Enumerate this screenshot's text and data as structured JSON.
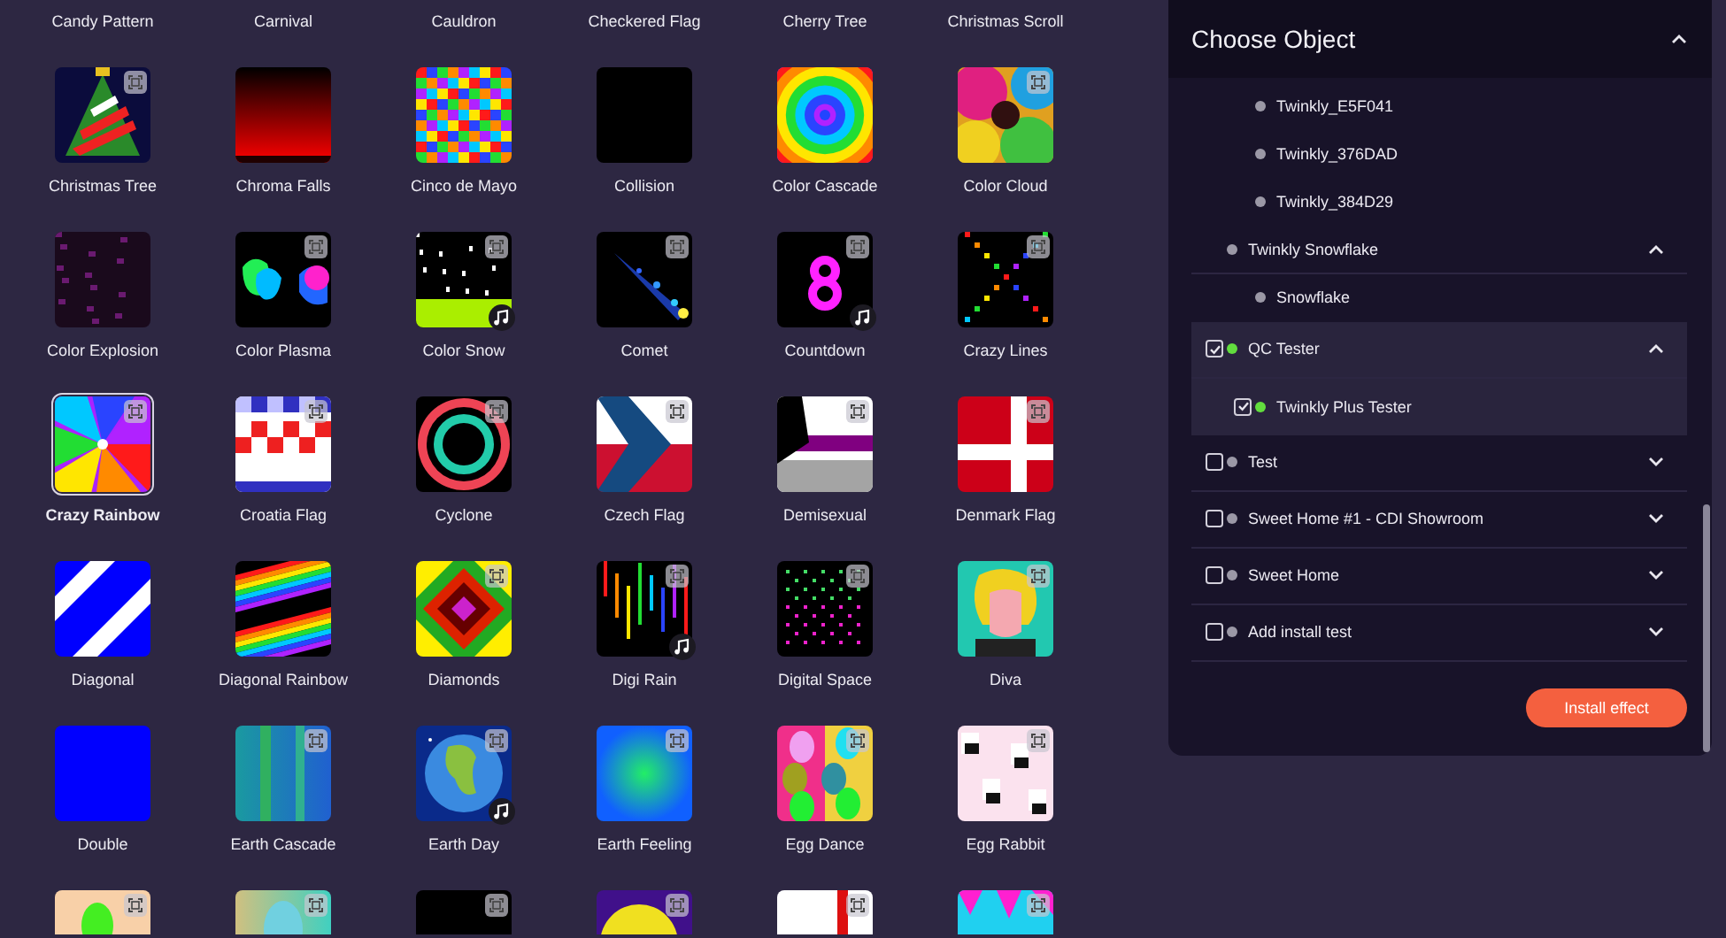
{
  "effects": [
    {
      "kind": "label",
      "label": "Candy Pattern",
      "selected": false
    },
    {
      "kind": "label",
      "label": "Carnival",
      "selected": false
    },
    {
      "kind": "label",
      "label": "Cauldron",
      "selected": false
    },
    {
      "kind": "label",
      "label": "Checkered Flag",
      "selected": false
    },
    {
      "kind": "label",
      "label": "Cherry Tree",
      "selected": false
    },
    {
      "kind": "label",
      "label": "Christmas Scroll",
      "selected": false
    },
    {
      "kind": "tile",
      "label": "Christmas Tree",
      "preview": true,
      "music": false,
      "selected": false
    },
    {
      "kind": "tile",
      "label": "Chroma Falls",
      "preview": false,
      "music": false,
      "selected": false
    },
    {
      "kind": "tile",
      "label": "Cinco de Mayo",
      "preview": false,
      "music": false,
      "selected": false
    },
    {
      "kind": "tile",
      "label": "Collision",
      "preview": false,
      "music": false,
      "selected": false
    },
    {
      "kind": "tile",
      "label": "Color Cascade",
      "preview": false,
      "music": false,
      "selected": false
    },
    {
      "kind": "tile",
      "label": "Color Cloud",
      "preview": true,
      "music": false,
      "selected": false
    },
    {
      "kind": "tile",
      "label": "Color Explosion",
      "preview": false,
      "music": false,
      "selected": false
    },
    {
      "kind": "tile",
      "label": "Color Plasma",
      "preview": true,
      "music": false,
      "selected": false
    },
    {
      "kind": "tile",
      "label": "Color Snow",
      "preview": true,
      "music": true,
      "selected": false
    },
    {
      "kind": "tile",
      "label": "Comet",
      "preview": true,
      "music": false,
      "selected": false
    },
    {
      "kind": "tile",
      "label": "Countdown",
      "preview": true,
      "music": true,
      "selected": false
    },
    {
      "kind": "tile",
      "label": "Crazy Lines",
      "preview": true,
      "music": false,
      "selected": false
    },
    {
      "kind": "tile",
      "label": "Crazy Rainbow",
      "preview": true,
      "music": false,
      "selected": true
    },
    {
      "kind": "tile",
      "label": "Croatia Flag",
      "preview": true,
      "music": false,
      "selected": false
    },
    {
      "kind": "tile",
      "label": "Cyclone",
      "preview": true,
      "music": false,
      "selected": false
    },
    {
      "kind": "tile",
      "label": "Czech Flag",
      "preview": true,
      "music": false,
      "selected": false
    },
    {
      "kind": "tile",
      "label": "Demisexual",
      "preview": true,
      "music": false,
      "selected": false
    },
    {
      "kind": "tile",
      "label": "Denmark Flag",
      "preview": true,
      "music": false,
      "selected": false
    },
    {
      "kind": "tile",
      "label": "Diagonal",
      "preview": false,
      "music": false,
      "selected": false
    },
    {
      "kind": "tile",
      "label": "Diagonal Rainbow",
      "preview": false,
      "music": false,
      "selected": false
    },
    {
      "kind": "tile",
      "label": "Diamonds",
      "preview": true,
      "music": false,
      "selected": false
    },
    {
      "kind": "tile",
      "label": "Digi Rain",
      "preview": true,
      "music": true,
      "selected": false
    },
    {
      "kind": "tile",
      "label": "Digital Space",
      "preview": true,
      "music": false,
      "selected": false
    },
    {
      "kind": "tile",
      "label": "Diva",
      "preview": true,
      "music": false,
      "selected": false
    },
    {
      "kind": "tile",
      "label": "Double",
      "preview": false,
      "music": false,
      "selected": false
    },
    {
      "kind": "tile",
      "label": "Earth Cascade",
      "preview": true,
      "music": false,
      "selected": false
    },
    {
      "kind": "tile",
      "label": "Earth Day",
      "preview": true,
      "music": true,
      "selected": false
    },
    {
      "kind": "tile",
      "label": "Earth Feeling",
      "preview": true,
      "music": false,
      "selected": false
    },
    {
      "kind": "tile",
      "label": "Egg Dance",
      "preview": true,
      "music": false,
      "selected": false
    },
    {
      "kind": "tile",
      "label": "Egg Rabbit",
      "preview": true,
      "music": false,
      "selected": false
    },
    {
      "kind": "partial",
      "preview": true,
      "music": false,
      "selected": false
    },
    {
      "kind": "partial",
      "preview": true,
      "music": false,
      "selected": false
    },
    {
      "kind": "partial",
      "preview": true,
      "music": false,
      "selected": false
    },
    {
      "kind": "partial",
      "preview": true,
      "music": false,
      "selected": false
    },
    {
      "kind": "partial",
      "preview": true,
      "music": false,
      "selected": false
    },
    {
      "kind": "partial",
      "preview": true,
      "music": false,
      "selected": false
    }
  ],
  "panel": {
    "title": "Choose Object",
    "expanded": true,
    "objects": [
      {
        "children": [
          {
            "name": "Twinkly_E5F041",
            "online": false
          },
          {
            "name": "Twinkly_376DAD",
            "online": false
          },
          {
            "name": "Twinkly_384D29",
            "online": false
          }
        ]
      },
      {
        "name": "Twinkly Snowflake",
        "online": false,
        "expanded": true,
        "children": [
          {
            "name": "Snowflake",
            "online": false
          }
        ]
      },
      {
        "name": "QC Tester",
        "checked": true,
        "online": true,
        "expanded": true,
        "children": [
          {
            "name": "Twinkly Plus Tester",
            "checked": true,
            "online": true
          }
        ]
      },
      {
        "name": "Test",
        "checked": false,
        "online": false,
        "expanded": false
      },
      {
        "name": "Sweet Home #1 - CDI Showroom",
        "checked": false,
        "online": false,
        "expanded": false
      },
      {
        "name": "Sweet Home",
        "checked": false,
        "online": false,
        "expanded": false
      },
      {
        "name": "Add install test",
        "checked": false,
        "online": false,
        "expanded": false
      }
    ],
    "button": "Install effect"
  }
}
